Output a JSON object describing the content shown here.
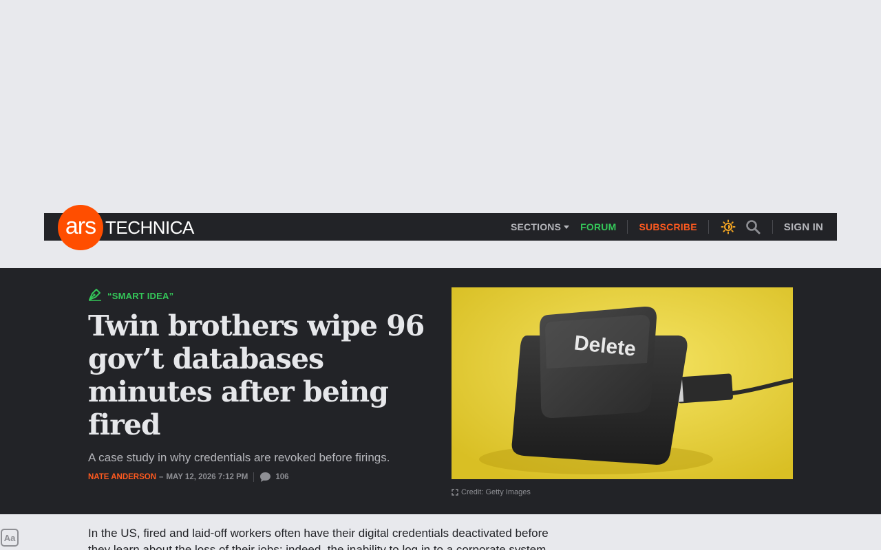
{
  "nav": {
    "logo_ars": "ars",
    "logo_word": "TECHNICA",
    "sections_label": "SECTIONS",
    "forum_label": "FORUM",
    "subscribe_label": "SUBSCRIBE",
    "signin_label": "SIGN IN",
    "icons": [
      "theme-toggle-icon",
      "search-icon"
    ]
  },
  "article": {
    "kicker": "“SMART IDEA”",
    "headline": "Twin brothers wipe 96 gov’t databases minutes after being fired",
    "dek": "A case study in why credentials are revoked before firings.",
    "author": "NATE ANDERSON",
    "byline_dash": "–",
    "date": "MAY 12, 2026 7:12 PM",
    "comment_count": "106",
    "image_key_label": "Delete",
    "image_credit": "Credit: Getty Images",
    "body_first_line": "In the US, fired and laid-off workers often have their digital credentials deactivated before",
    "body_second_line": "they learn about the loss of their jobs; indeed, the inability to log in to a corporate system"
  },
  "reader": {
    "aa_label": "Aa"
  },
  "colors": {
    "brand_orange": "#ff4e00",
    "accent_green": "#34c759",
    "dark_bg": "#222327",
    "page_bg": "#e8e9ed"
  }
}
